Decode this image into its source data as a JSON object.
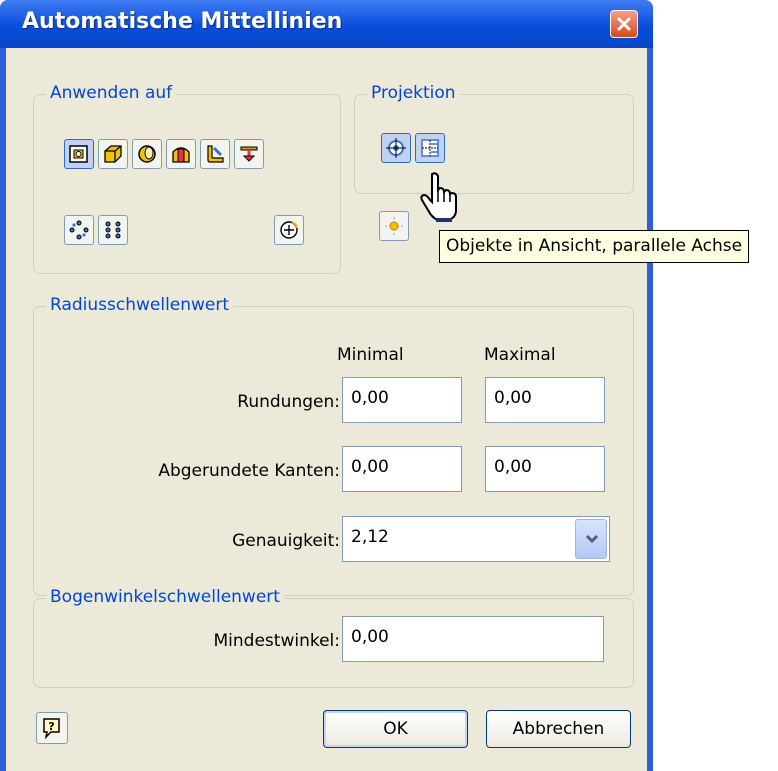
{
  "window": {
    "title": "Automatische Mittellinien"
  },
  "apply_to": {
    "label": "Anwenden auf"
  },
  "projection": {
    "label": "Projektion"
  },
  "radius": {
    "label": "Radiusschwellenwert",
    "col_min": "Minimal",
    "col_max": "Maximal",
    "rows": [
      {
        "label": "Rundungen:",
        "min": "0,00",
        "max": "0,00"
      },
      {
        "label": "Abgerundete Kanten:",
        "min": "0,00",
        "max": "0,00"
      }
    ],
    "precision_label": "Genauigkeit:",
    "precision_value": "2,12"
  },
  "arc": {
    "label": "Bogenwinkelschwellenwert",
    "min_angle_label": "Mindestwinkel:",
    "min_angle_value": "0,00"
  },
  "buttons": {
    "ok": "OK",
    "cancel": "Abbrechen"
  },
  "tooltip": "Objekte in Ansicht, parallele Achse",
  "colors": {
    "title_bar": "#0a4ddc",
    "dialog_bg": "#ece9d8",
    "group_label": "#0046d5",
    "tooltip_bg": "#ffffe1"
  }
}
